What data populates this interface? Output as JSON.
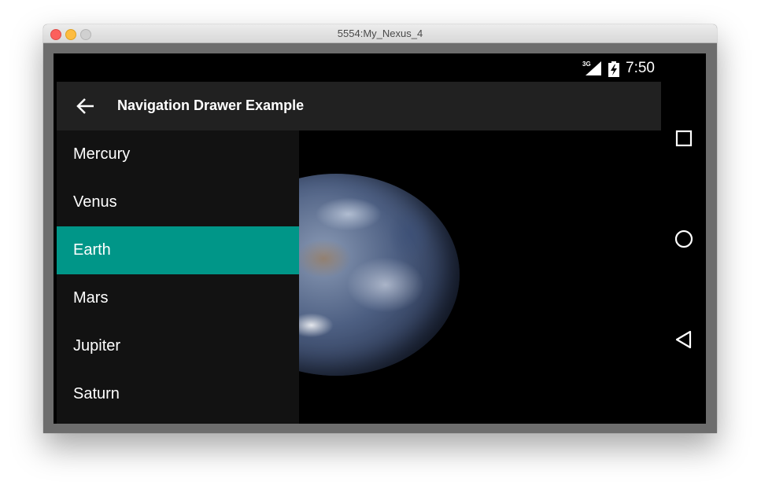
{
  "window": {
    "title": "5554:My_Nexus_4"
  },
  "status_bar": {
    "network": "3G",
    "time": "7:50"
  },
  "app_bar": {
    "title": "Navigation Drawer Example",
    "back_icon": "arrow-back-icon"
  },
  "drawer": {
    "items": [
      {
        "label": "Mercury",
        "selected": false
      },
      {
        "label": "Venus",
        "selected": false
      },
      {
        "label": "Earth",
        "selected": true
      },
      {
        "label": "Mars",
        "selected": false
      },
      {
        "label": "Jupiter",
        "selected": false
      },
      {
        "label": "Saturn",
        "selected": false
      }
    ]
  },
  "nav_bar": {
    "icons": [
      "recents-square-icon",
      "home-circle-icon",
      "back-triangle-icon"
    ]
  },
  "colors": {
    "accent": "#009688",
    "app_bar": "#212121",
    "drawer": "#121212"
  }
}
